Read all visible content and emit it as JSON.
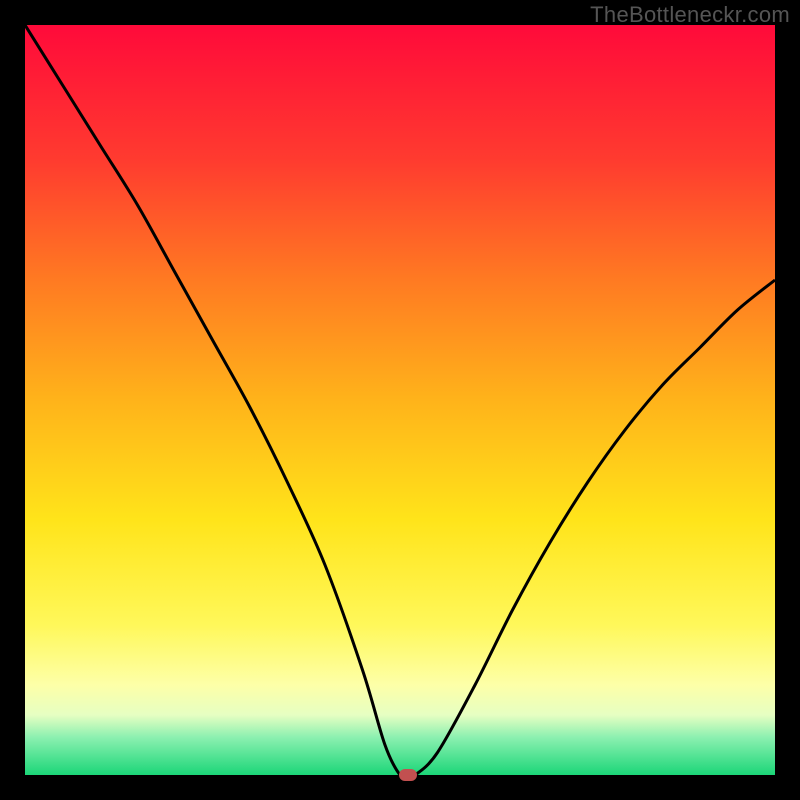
{
  "watermark": "TheBottleneckr.com",
  "chart_data": {
    "type": "line",
    "title": "",
    "xlabel": "",
    "ylabel": "",
    "xlim": [
      0,
      100
    ],
    "ylim": [
      0,
      100
    ],
    "grid": false,
    "legend": false,
    "series": [
      {
        "name": "curve",
        "x": [
          0,
          5,
          10,
          15,
          20,
          25,
          30,
          35,
          40,
          45,
          48,
          50,
          51,
          52,
          55,
          60,
          65,
          70,
          75,
          80,
          85,
          90,
          95,
          100
        ],
        "y": [
          100,
          92,
          84,
          76,
          67,
          58,
          49,
          39,
          28,
          14,
          4,
          0,
          0,
          0,
          3,
          12,
          22,
          31,
          39,
          46,
          52,
          57,
          62,
          66
        ]
      }
    ],
    "marker": {
      "x": 51,
      "y": 0
    },
    "background": "red-yellow-green-vertical-gradient"
  }
}
